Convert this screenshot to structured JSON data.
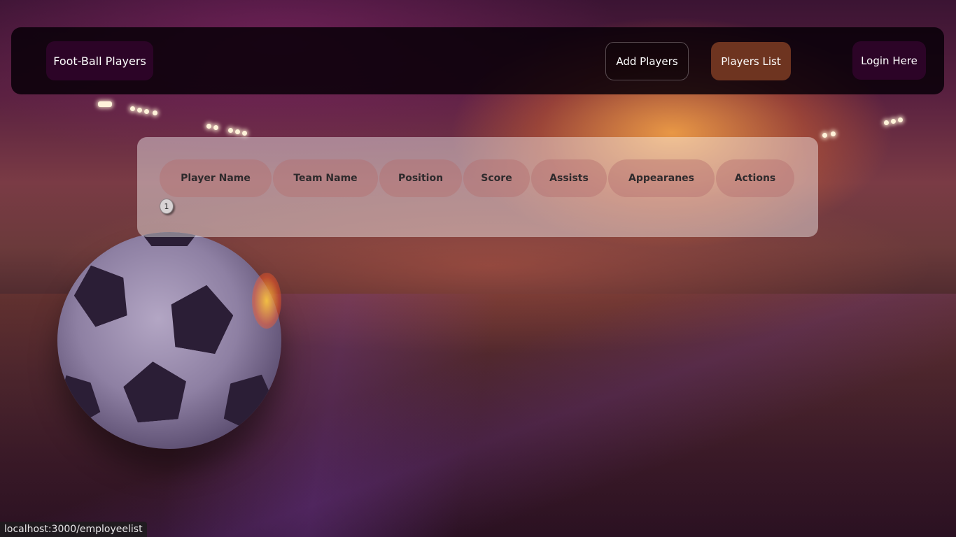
{
  "navbar": {
    "brand": "Foot-Ball Players",
    "add_players": "Add Players",
    "players_list": "Players List",
    "login": "Login Here"
  },
  "table": {
    "columns": [
      "Player Name",
      "Team Name",
      "Position",
      "Score",
      "Assists",
      "Appearanes",
      "Actions"
    ],
    "rows": [],
    "page_number": "1"
  },
  "status_bar": {
    "url": "localhost:3000/employeelist"
  },
  "colors": {
    "navbar_bg": "#080008",
    "brand_bg": "#2c0427",
    "players_list_bg": "#6e3420",
    "login_bg": "#2c0427"
  }
}
